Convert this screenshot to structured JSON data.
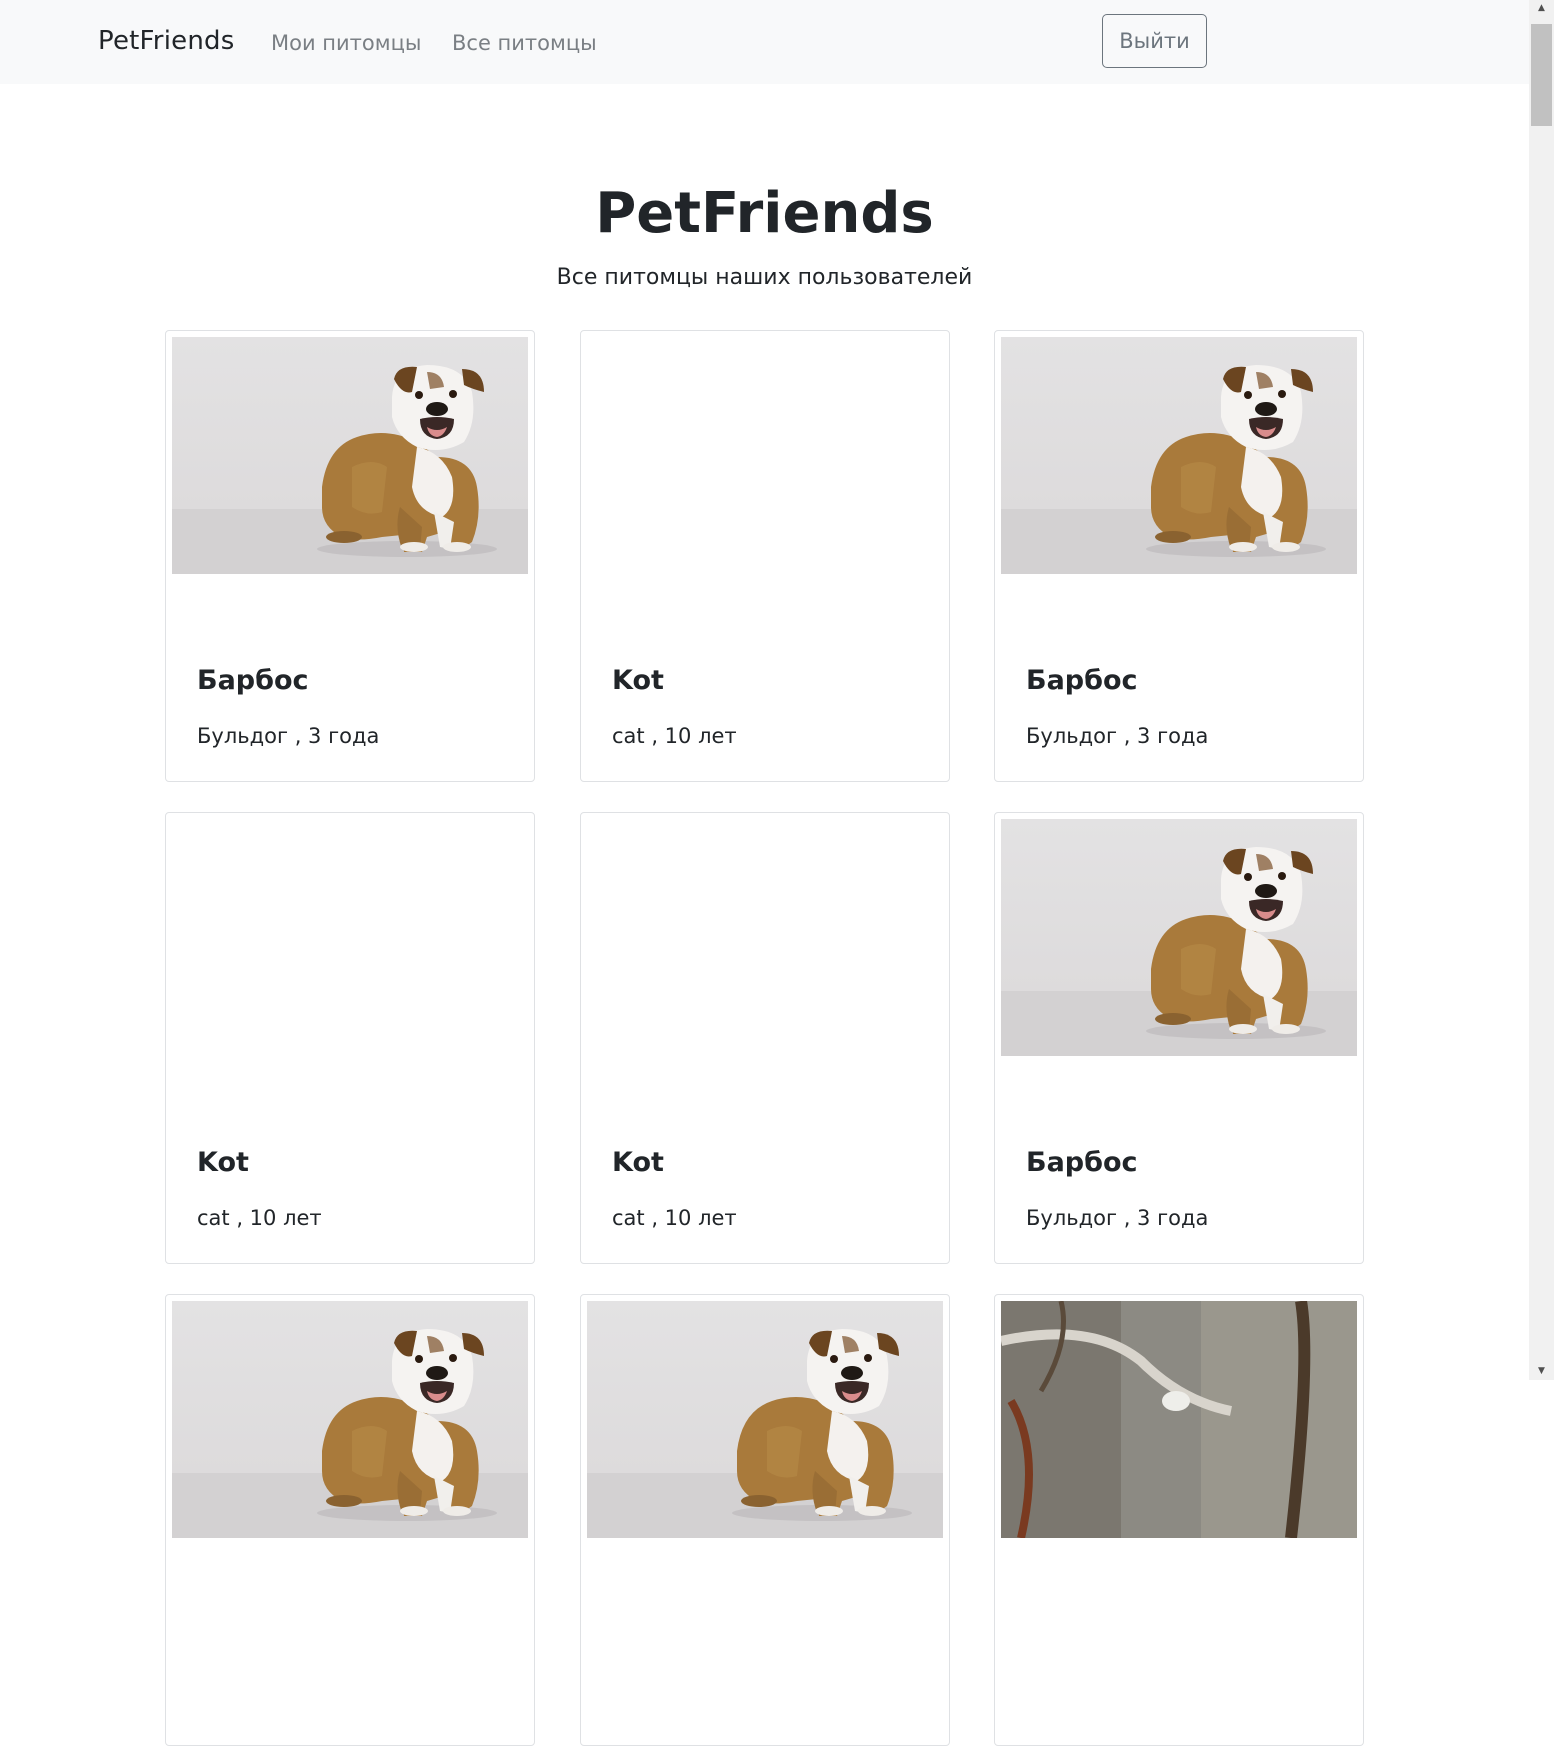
{
  "navbar": {
    "brand": "PetFriends",
    "links": [
      "Мои питомцы",
      "Все питомцы"
    ],
    "logout_label": "Выйти"
  },
  "header": {
    "title": "PetFriends",
    "subtitle": "Все питомцы наших пользователей"
  },
  "pets": [
    {
      "name": "Барбос",
      "info": "Бульдог , 3 года",
      "photo": "bulldog"
    },
    {
      "name": "Kot",
      "info": "cat , 10 лет",
      "photo": "none"
    },
    {
      "name": "Барбос",
      "info": "Бульдог , 3 года",
      "photo": "bulldog"
    },
    {
      "name": "Kot",
      "info": "cat , 10 лет",
      "photo": "none"
    },
    {
      "name": "Kot",
      "info": "cat , 10 лет",
      "photo": "none"
    },
    {
      "name": "Барбос",
      "info": "Бульдог , 3 года",
      "photo": "bulldog"
    },
    {
      "name": "",
      "info": "",
      "photo": "bulldog"
    },
    {
      "name": "",
      "info": "",
      "photo": "bulldog"
    },
    {
      "name": "",
      "info": "",
      "photo": "bird-on-branch"
    }
  ],
  "icons": {
    "scroll_up": "up-arrow-icon",
    "scroll_down": "down-arrow-icon"
  }
}
